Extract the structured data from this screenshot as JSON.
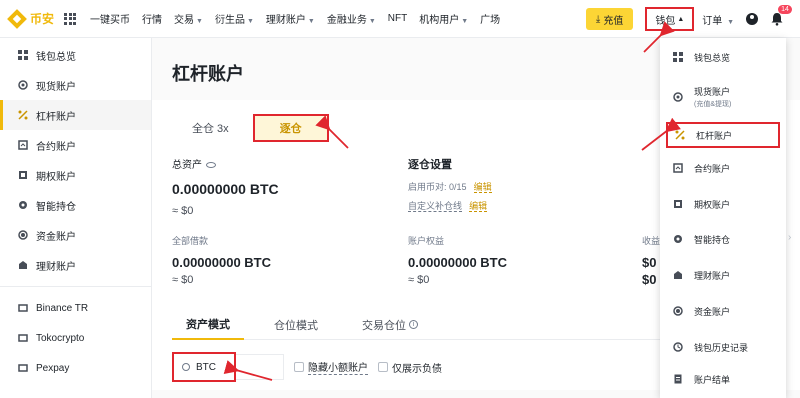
{
  "brand": {
    "name": "币安"
  },
  "nav": {
    "items": [
      "一键买币",
      "行情",
      "交易",
      "衍生品",
      "理财账户",
      "金融业务",
      "NFT",
      "机构用户",
      "广场"
    ],
    "caret_flags": [
      false,
      false,
      true,
      true,
      true,
      true,
      false,
      true,
      false
    ]
  },
  "header": {
    "deposit": "充值",
    "wallet": "钱包",
    "orders": "订单",
    "notification_count": "14"
  },
  "sidebar": {
    "items": [
      {
        "label": "钱包总览",
        "icon": "grid-icon"
      },
      {
        "label": "现货账户",
        "icon": "spot-icon"
      },
      {
        "label": "杠杆账户",
        "icon": "margin-icon",
        "active": true
      },
      {
        "label": "合约账户",
        "icon": "futures-icon"
      },
      {
        "label": "期权账户",
        "icon": "options-icon"
      },
      {
        "label": "智能持仓",
        "icon": "smart-icon"
      },
      {
        "label": "资金账户",
        "icon": "funding-icon"
      },
      {
        "label": "理财账户",
        "icon": "earn-icon"
      }
    ],
    "partners": [
      "Binance TR",
      "Tokocrypto",
      "Pexpay"
    ]
  },
  "main": {
    "title": "杠杆账户",
    "tabs": [
      "全仓 3x",
      "逐仓"
    ],
    "total_assets_label": "总资产",
    "total_assets_value": "0.00000000 BTC",
    "total_assets_fiat": "≈ $0",
    "settings_title": "逐仓设置",
    "enabled_pairs_label": "启用币对: 0/15",
    "edit_label": "编辑",
    "custom_liquidation_label": "自定义补仓线",
    "total_borrowed_label": "全部借款",
    "total_borrowed_value": "0.00000000 BTC",
    "total_borrowed_fiat": "≈ $0",
    "equity_label": "账户权益",
    "equity_value": "0.00000000 BTC",
    "equity_fiat": "≈ $0",
    "profit_label": "收益",
    "profit_value": "$0",
    "profit_value2": "$0",
    "view_tabs": [
      "资产模式",
      "仓位模式",
      "交易仓位"
    ],
    "search_value": "BTC",
    "hide_small_label": "隐藏小额账户",
    "show_debt_label": "仅展示负债"
  },
  "dropdown": {
    "items": [
      {
        "label": "钱包总览",
        "icon": "grid-icon"
      },
      {
        "label": "现货账户",
        "sub": "(充值&提现)",
        "icon": "spot-icon"
      },
      {
        "label": "杠杆账户",
        "icon": "margin-icon",
        "highlighted": true
      },
      {
        "label": "合约账户",
        "icon": "futures-icon"
      },
      {
        "label": "期权账户",
        "icon": "options-icon"
      },
      {
        "label": "智能持仓",
        "icon": "smart-icon"
      },
      {
        "label": "理财账户",
        "icon": "earn-icon"
      },
      {
        "label": "资金账户",
        "icon": "funding-icon"
      },
      {
        "label": "钱包历史记录",
        "icon": "history-icon"
      },
      {
        "label": "账户结单",
        "icon": "statement-icon"
      }
    ]
  },
  "colors": {
    "brand": "#f0b90b",
    "highlight": "#e0262e",
    "link": "#c99400"
  }
}
